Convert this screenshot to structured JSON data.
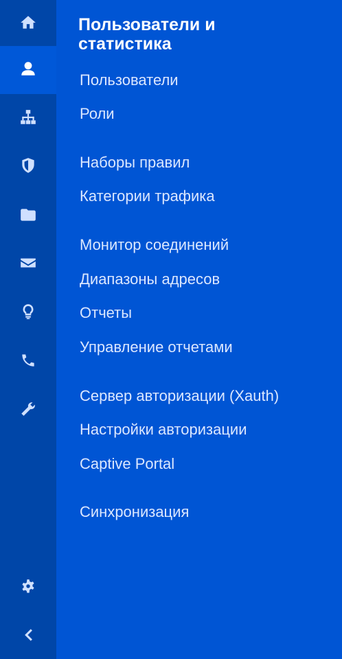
{
  "rail": {
    "items": [
      {
        "name": "home-icon",
        "active": false
      },
      {
        "name": "user-icon",
        "active": true
      },
      {
        "name": "sitemap-icon",
        "active": false
      },
      {
        "name": "shield-icon",
        "active": false
      },
      {
        "name": "folder-icon",
        "active": false
      },
      {
        "name": "envelope-icon",
        "active": false
      },
      {
        "name": "lightbulb-icon",
        "active": false
      },
      {
        "name": "phone-icon",
        "active": false
      },
      {
        "name": "wrench-icon",
        "active": false
      }
    ],
    "bottom": [
      {
        "name": "gear-icon"
      },
      {
        "name": "chevron-left-icon"
      }
    ]
  },
  "menu": {
    "title": "Пользователи и статистика",
    "items": [
      {
        "label": "Пользователи"
      },
      {
        "label": "Роли"
      },
      {
        "label": "Наборы правил"
      },
      {
        "label": "Категории трафика"
      },
      {
        "label": "Монитор соединений"
      },
      {
        "label": "Диапазоны адресов"
      },
      {
        "label": "Отчеты"
      },
      {
        "label": "Управление отчетами"
      },
      {
        "label": "Сервер авторизации (Xauth)"
      },
      {
        "label": "Настройки авторизации"
      },
      {
        "label": "Captive Portal"
      },
      {
        "label": "Синхронизация"
      }
    ]
  },
  "colors": {
    "rail_bg": "#0046a8",
    "menu_bg": "#0055d4",
    "active_bg": "#0058d8",
    "text": "#dbe7ff",
    "title": "#ffffff"
  }
}
